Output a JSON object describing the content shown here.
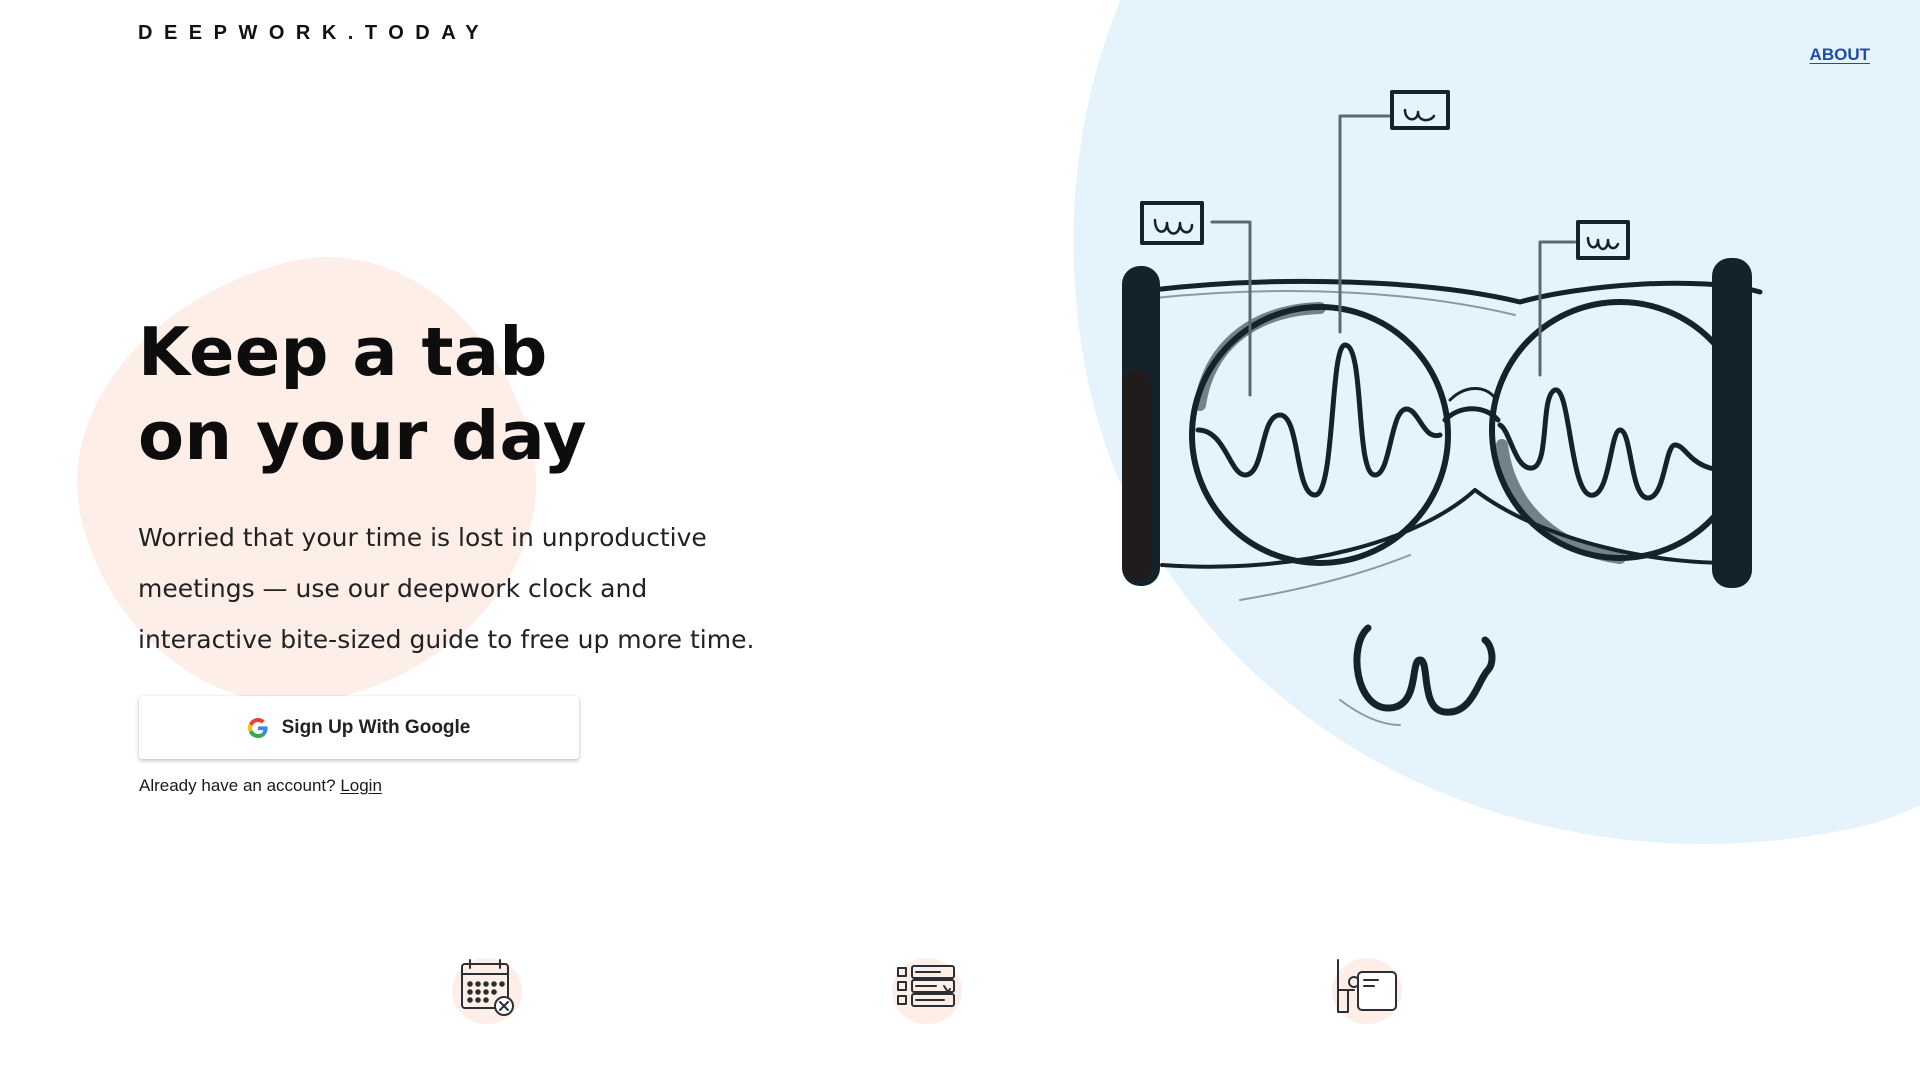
{
  "brand": {
    "name": "DEEPWORK.TODAY"
  },
  "nav": {
    "about_label": "ABOUT"
  },
  "hero": {
    "title_lines": [
      "Keep a tab",
      "on your day"
    ],
    "body_lines": [
      "Worried that your time is lost in unproductive",
      "meetings — use our deepwork clock and",
      "interactive bite-sized guide to free up more time."
    ]
  },
  "signup": {
    "button_label": "Sign Up With Google",
    "button_icon": "google-g-icon",
    "already_text": "Already have an account? ",
    "login_label": "Login"
  },
  "illustration": {
    "name": "glasses-with-signal-waves-illustration"
  },
  "features": [
    {
      "icon": "calendar-cancel-icon"
    },
    {
      "icon": "checklist-icon"
    },
    {
      "icon": "desk-tablet-icon"
    }
  ],
  "colors": {
    "pink_blob": "#fdeee8",
    "blue_blob": "#e5f3fc",
    "about_link": "#1f4ca6",
    "ink": "#14232b"
  }
}
